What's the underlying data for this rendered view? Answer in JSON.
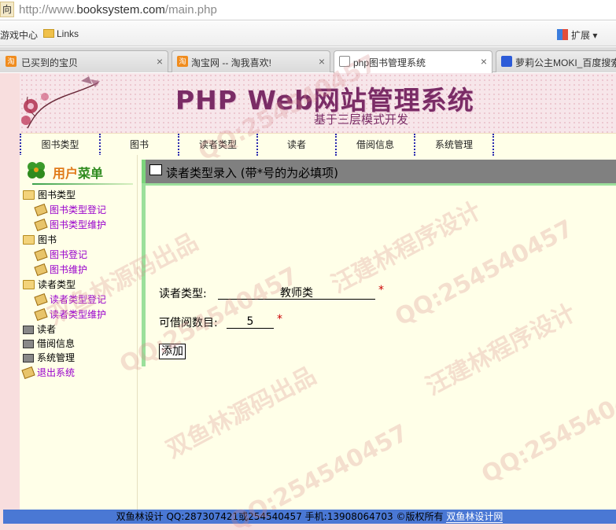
{
  "browser": {
    "nav_glyph": "向",
    "url_prefix": "http://www.",
    "url_host": "booksystem.com",
    "url_path": "/main.php",
    "favorites": [
      "游戏中心",
      "Links"
    ],
    "extensions_label": "扩展",
    "tabs": [
      {
        "label": "已买到的宝贝",
        "active": false
      },
      {
        "label": "淘宝网 -- 淘我喜欢!",
        "active": false
      },
      {
        "label": "php图书管理系统",
        "active": true
      },
      {
        "label": "萝莉公主MOKI_百度搜索",
        "active": false
      }
    ]
  },
  "banner": {
    "title": "PHP Web网站管理系统",
    "subtitle": "基于三层模式开发"
  },
  "nav": [
    "图书类型",
    "图书",
    "读者类型",
    "读者",
    "借阅信息",
    "系统管理"
  ],
  "sidebar": {
    "title_a": "用户",
    "title_b": "菜单",
    "tree": [
      {
        "label": "图书类型",
        "type": "folder"
      },
      {
        "label": "图书类型登记",
        "type": "link"
      },
      {
        "label": "图书类型维护",
        "type": "link"
      },
      {
        "label": "图书",
        "type": "folder"
      },
      {
        "label": "图书登记",
        "type": "link"
      },
      {
        "label": "图书维护",
        "type": "link"
      },
      {
        "label": "读者类型",
        "type": "folder"
      },
      {
        "label": "读者类型登记",
        "type": "link"
      },
      {
        "label": "读者类型维护",
        "type": "link"
      },
      {
        "label": "读者",
        "type": "book"
      },
      {
        "label": "借阅信息",
        "type": "book"
      },
      {
        "label": "系统管理",
        "type": "book"
      },
      {
        "label": "退出系统",
        "type": "exit"
      }
    ]
  },
  "form": {
    "title": "读者类型录入 (带*号的为必填项)",
    "reader_type_label": "读者类型:",
    "reader_type_value": "教师类",
    "borrow_count_label": "可借阅数目:",
    "borrow_count_value": "5",
    "required_mark": "*",
    "submit_label": "添加"
  },
  "footer": {
    "text": "双鱼林设计 QQ:287307421或254540457 手机:13908064703 ©版权所有 ",
    "link": "双鱼林设计网"
  },
  "watermarks": [
    "QQ:254540457",
    "双鱼林源码出品",
    "汪建林程序设计",
    "QQ:254540457",
    "双鱼林源码出品",
    "汪建林程序设计",
    "QQ:254540457",
    "QQ:254540457"
  ],
  "colors": {
    "banner_text": "#7a2c66",
    "link": "#9900cc",
    "footer_bg": "#4a78d4",
    "panel_accent": "#9be09b"
  }
}
